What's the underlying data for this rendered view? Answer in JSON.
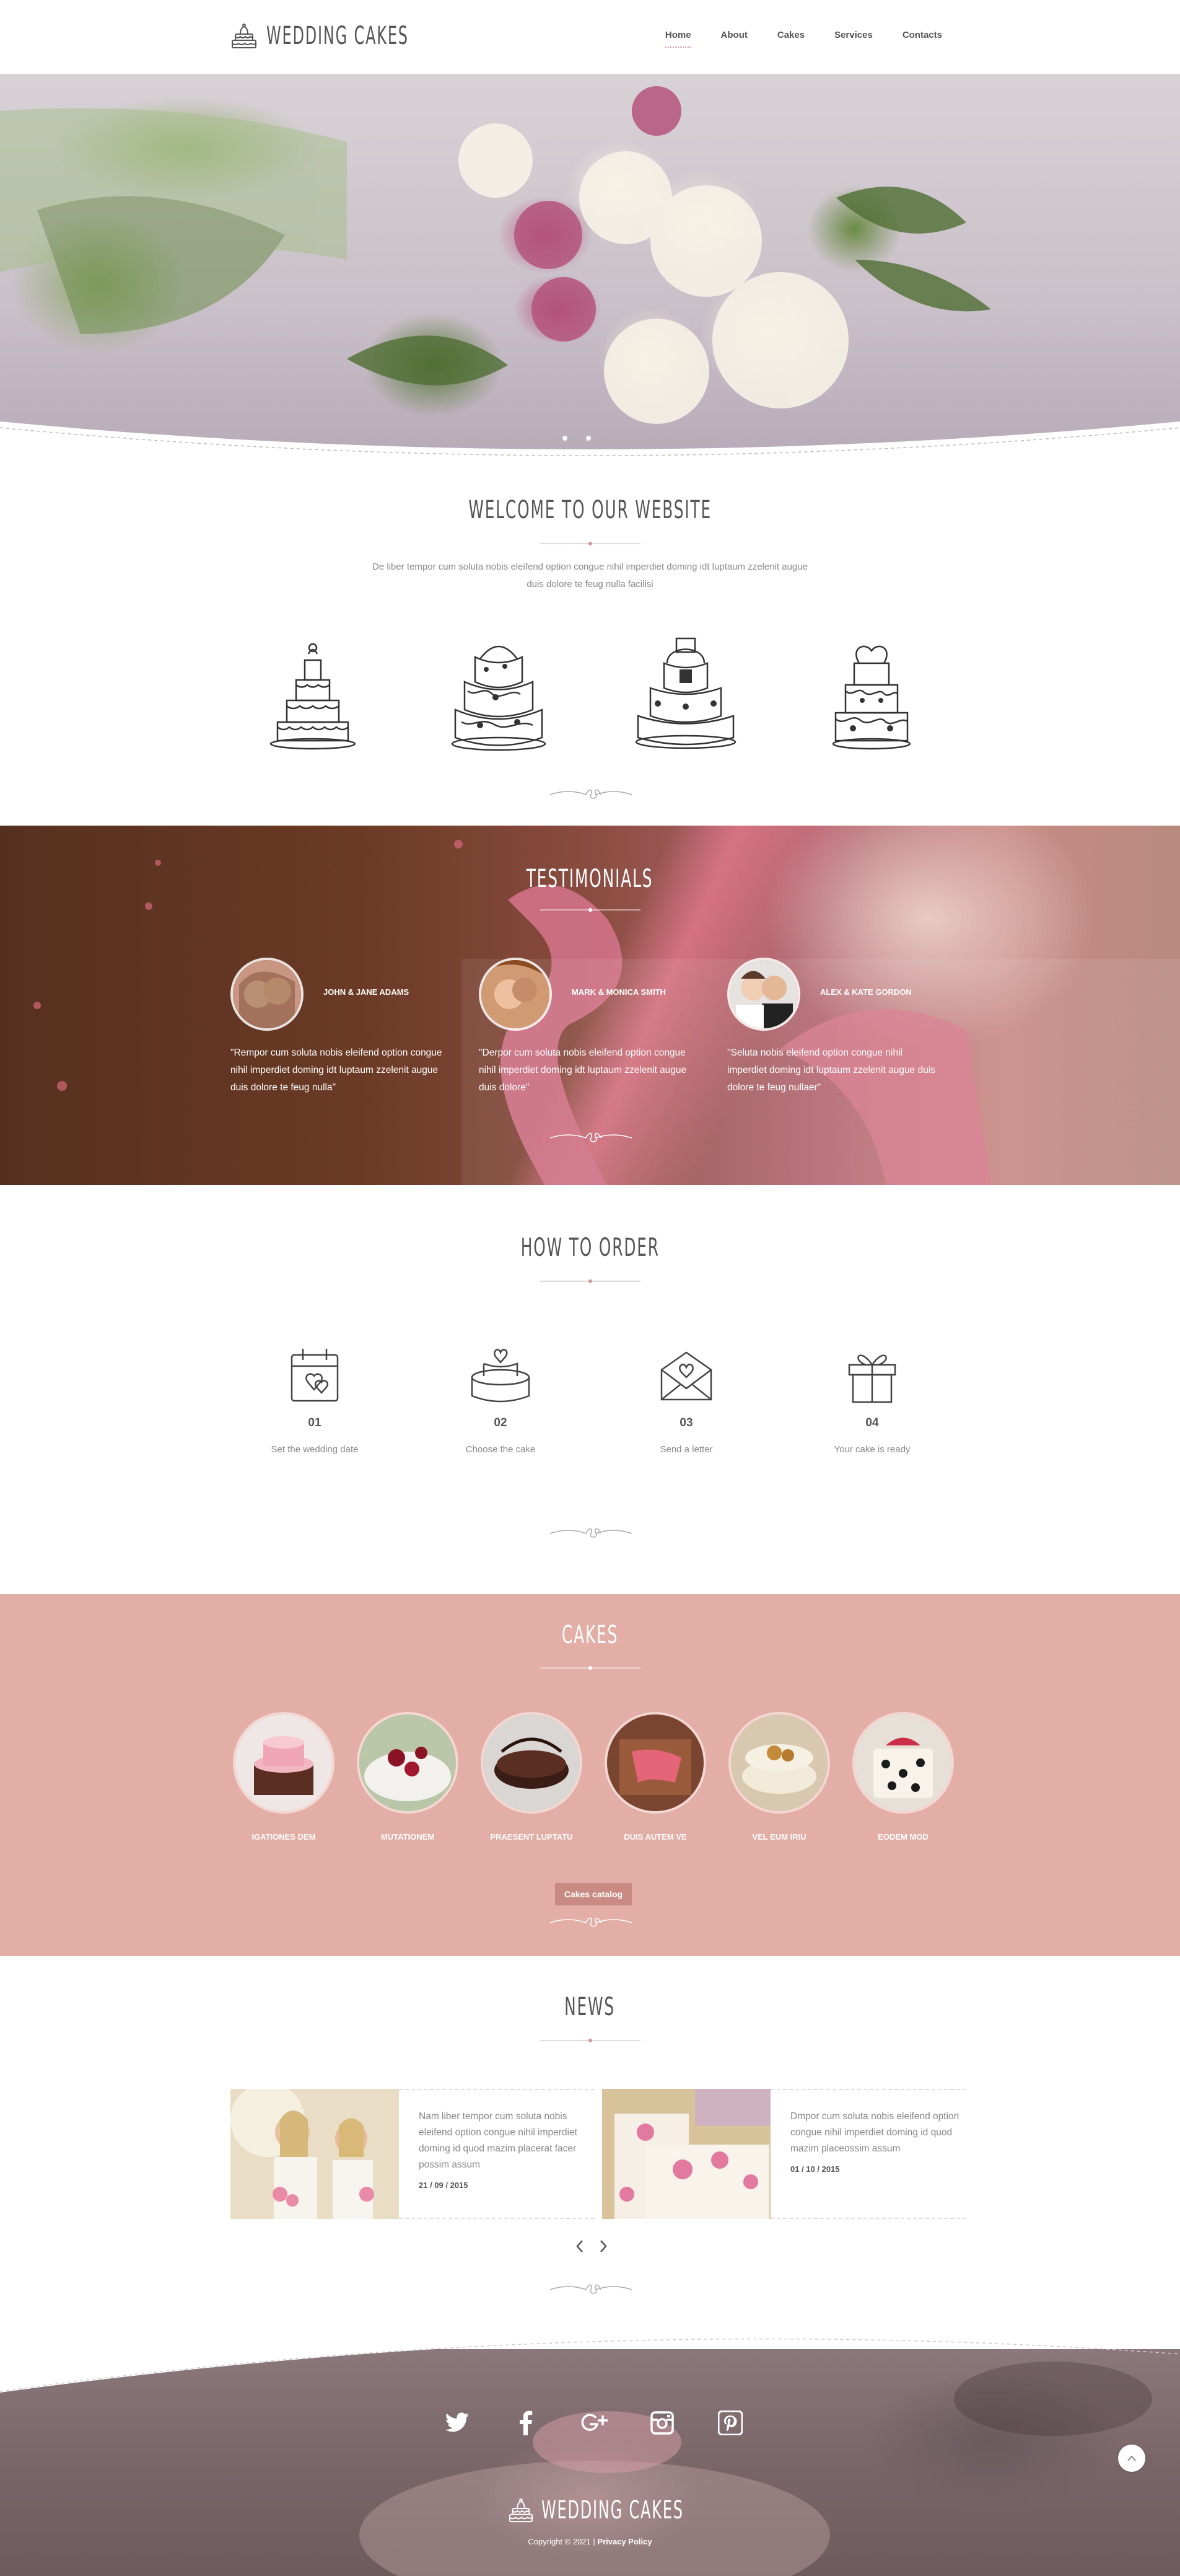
{
  "header": {
    "logo_text": "Wedding Cakes",
    "nav": [
      "Home",
      "About",
      "Cakes",
      "Services",
      "Contacts"
    ]
  },
  "hero": {
    "slides": 2
  },
  "welcome": {
    "title": "Welcome to our website",
    "text": "De liber tempor cum soluta nobis eleifend option congue nihil imperdiet doming idt luptaum zzelenit augue duis dolore te feug nulla facilisi"
  },
  "testimonials": {
    "title": "Testimonials",
    "items": [
      {
        "name": "JOHN & JANE ADAMS",
        "quote": "\"Rempor cum soluta nobis eleifend option congue nihil imperdiet doming idt luptaum zzelenit augue duis dolore te feug nulla\""
      },
      {
        "name": "MARK & MONICA SMITH",
        "quote": "\"Derpor cum soluta nobis eleifend option congue nihil imperdiet doming idt luptaum zzelenit augue duis dolore\""
      },
      {
        "name": "ALEX & KATE GORDON",
        "quote": "\"Seluta nobis eleifend option congue nihil imperdiet doming idt luptaum zzelenit augue duis dolore te feug nullaer\""
      }
    ]
  },
  "order": {
    "title": "How to order",
    "steps": [
      {
        "num": "01",
        "label": "Set the wedding date",
        "icon": "calendar-heart-icon"
      },
      {
        "num": "02",
        "label": "Choose the cake",
        "icon": "cake-icon"
      },
      {
        "num": "03",
        "label": "Send a letter",
        "icon": "envelope-heart-icon"
      },
      {
        "num": "04",
        "label": "Your cake is ready",
        "icon": "gift-icon"
      }
    ]
  },
  "cakes": {
    "title": "Cakes",
    "items": [
      "IGATIONES DEM",
      "MUTATIONEM",
      "PRAESENT LUPTATU",
      "DUIS AUTEM VE",
      "VEL EUM IRIU",
      "EODEM MOD"
    ],
    "button": "Cakes catalog"
  },
  "news": {
    "title": "News",
    "items": [
      {
        "text": "Nam liber tempor cum soluta nobis eleifend option congue nihil imperdiet doming id quod mazim placerat facer possim assum",
        "date": "21 / 09 / 2015"
      },
      {
        "text": "Dmpor cum soluta nobis eleifend option congue nihil imperdiet doming id quod mazim placeossim assum",
        "date": "01 / 10 / 2015"
      }
    ]
  },
  "footer": {
    "socials": [
      "twitter-icon",
      "facebook-icon",
      "google-plus-icon",
      "instagram-icon",
      "pinterest-icon"
    ],
    "logo_text": "Wedding Cakes",
    "copyright": "Copyright © 2021",
    "separator": "|",
    "privacy": "Privacy Policy"
  },
  "colors": {
    "accent_pink": "#e2aea6",
    "button": "#c88a82",
    "text": "#555555"
  }
}
